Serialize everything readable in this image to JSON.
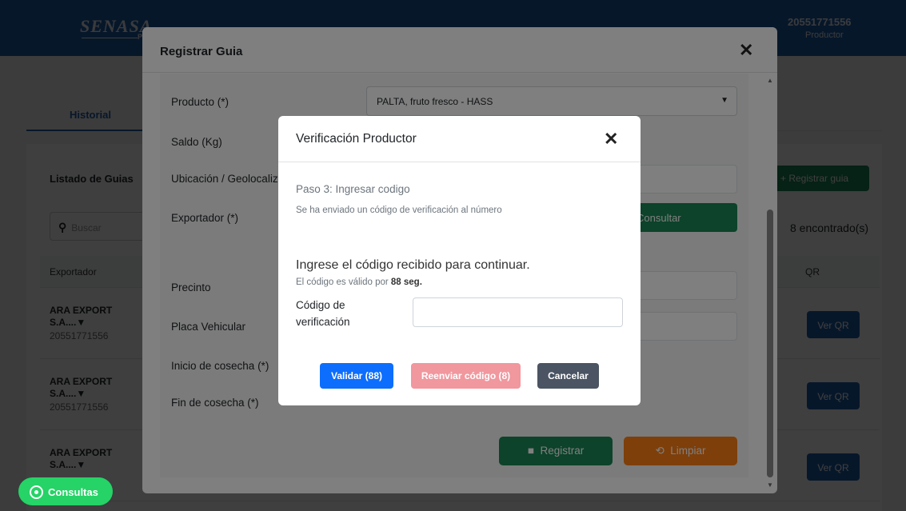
{
  "app": {
    "logo": "SENASA",
    "logo_sub": "PE",
    "user_ruc": "20551771556",
    "user_role": "Productor"
  },
  "tabs": {
    "historial": "Historial"
  },
  "list": {
    "title": "Listado de Guias",
    "register_button": "+ Registrar guia",
    "search_placeholder": "Buscar",
    "count": "8 encontrado(s)",
    "columns": {
      "exportador": "Exportador",
      "qr": "QR"
    },
    "rows": [
      {
        "name_line1": "ARA EXPORT",
        "name_line2": "S.A....▼",
        "ruc": "20551771556",
        "qr_button": "Ver QR"
      },
      {
        "name_line1": "ARA EXPORT",
        "name_line2": "S.A....▼",
        "ruc": "20551771556",
        "qr_button": "Ver QR"
      },
      {
        "name_line1": "ARA EXPORT",
        "name_line2": "S.A....▼",
        "ruc": "",
        "qr_button": "Ver QR"
      }
    ]
  },
  "whatsapp": {
    "label": "Consultas"
  },
  "modal_registrar": {
    "title": "Registrar Guia",
    "close": "✕",
    "labels": {
      "producto": "Producto (*)",
      "saldo": "Saldo (Kg)",
      "ubicacion": "Ubicación / Geolocalización",
      "exportador": "Exportador (*)",
      "precinto": "Precinto",
      "placa": "Placa Vehicular",
      "inicio": "Inicio de cosecha (*)",
      "fin": "Fin de cosecha (*)"
    },
    "producto_value": "PALTA, fruto fresco - HASS",
    "consultar_button": "Consultar",
    "registrar_button": "Registrar",
    "limpiar_button": "Limpiar"
  },
  "modal_verificacion": {
    "title": "Verificación Productor",
    "close": "✕",
    "step": "Paso 3: Ingresar codigo",
    "sent_message": "Se ha enviado un código de verificación al número",
    "prompt": "Ingrese el código recibido para continuar.",
    "validity_prefix": "El código es válido por ",
    "validity_value": "88 seg.",
    "code_label": "Código de verificación",
    "code_value": "",
    "validar_button": "Validar (88)",
    "reenviar_button": "Reenviar código (8)",
    "cancelar_button": "Cancelar"
  },
  "colors": {
    "primary": "#1f5da8",
    "success": "#198754",
    "warning": "#fd7e14",
    "validar": "#0d6efd",
    "reenviar": "#f1979e",
    "cancelar": "#4a5462",
    "whatsapp": "#25d366"
  }
}
